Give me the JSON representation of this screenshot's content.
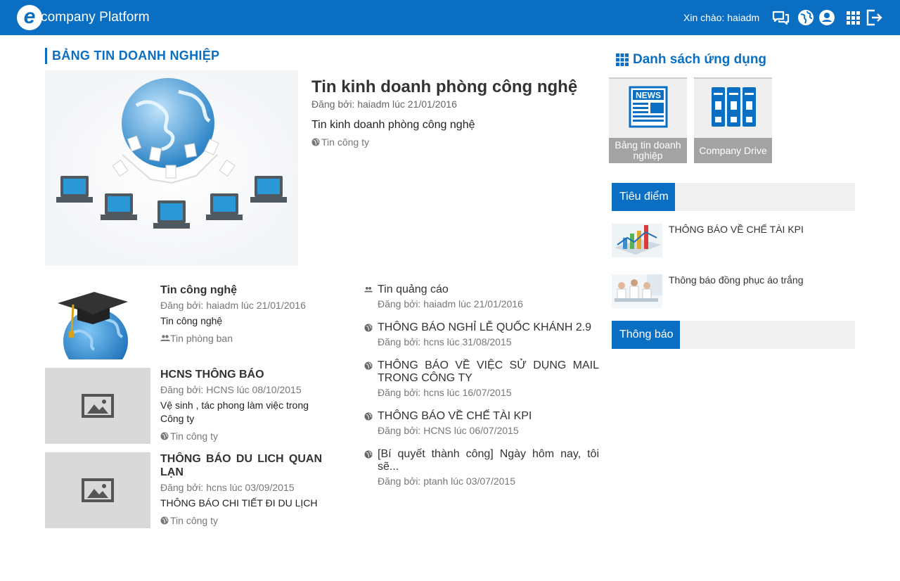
{
  "header": {
    "logo_letter": "e",
    "logo_text": "company Platform",
    "greeting": "Xin chào: haiadm",
    "icons": [
      "chat-icon",
      "globe-icon",
      "user-icon",
      "apps-grid-icon",
      "logout-icon"
    ]
  },
  "main": {
    "section_title": "BẢNG TIN DOANH NGHIỆP",
    "featured": {
      "title": "Tin kinh doanh phòng công nghệ",
      "meta": "Đăng bởi: haiadm lúc 21/01/2016",
      "description": "Tin kinh doanh phòng công nghệ",
      "category": "Tin công ty"
    },
    "left_items": [
      {
        "title": "Tin công nghệ",
        "meta": "Đăng bởi: haiadm lúc 21/01/2016",
        "description": "Tin công nghệ",
        "category": "Tin phòng ban"
      },
      {
        "title": "HCNS THÔNG BÁO",
        "meta": "Đăng bởi: HCNS lúc 08/10/2015",
        "description": "Vệ sinh , tác phong làm việc trong Công ty",
        "category": "Tin công ty"
      },
      {
        "title": "THÔNG BÁO DU LICH QUAN LẠN",
        "meta": "Đăng bởi: hcns lúc 03/09/2015",
        "description": "THÔNG BÁO CHI TIẾT ĐI DU LỊCH",
        "category": "Tin công ty"
      }
    ],
    "middle_items": [
      {
        "title": "Tin quảng cáo",
        "meta": "Đăng bởi: haiadm lúc 21/01/2016",
        "icon": "group-icon"
      },
      {
        "title": "THÔNG BÁO NGHỈ LỄ QUỐC KHÁNH 2.9",
        "meta": "Đăng bởi: hcns lúc 31/08/2015",
        "icon": "globe-icon"
      },
      {
        "title": "THÔNG BÁO VỀ VIỆC SỬ DỤNG MAIL TRONG CÔNG TY",
        "meta": "Đăng bởi: hcns lúc 16/07/2015",
        "icon": "globe-icon"
      },
      {
        "title": "THÔNG BÁO VỀ CHẾ TÀI KPI",
        "meta": "Đăng bởi: HCNS lúc 06/07/2015",
        "icon": "globe-icon"
      },
      {
        "title": "[Bí quyết thành công] Ngày hôm nay, tôi sẽ...",
        "meta": "Đăng bởi: ptanh lúc 03/07/2015",
        "icon": "globe-icon"
      }
    ]
  },
  "sidebar": {
    "apps_title": "Danh sách ứng dụng",
    "apps": [
      {
        "label": "Bảng tin doanh nghiệp",
        "icon": "news-icon",
        "icon_text": "NEWS"
      },
      {
        "label": "Company Drive",
        "icon": "binders-icon"
      }
    ],
    "focus_title": "Tiêu điểm",
    "focus_items": [
      {
        "title": "THÔNG BÁO VỀ CHẾ TÀI KPI"
      },
      {
        "title": "Thông báo đồng phục áo trắng"
      }
    ],
    "notice_title": "Thông báo"
  },
  "colors": {
    "brand": "#0a6fc2",
    "tile_label_bg": "#a3a3a3",
    "panel_bg": "#f0f0f0"
  }
}
